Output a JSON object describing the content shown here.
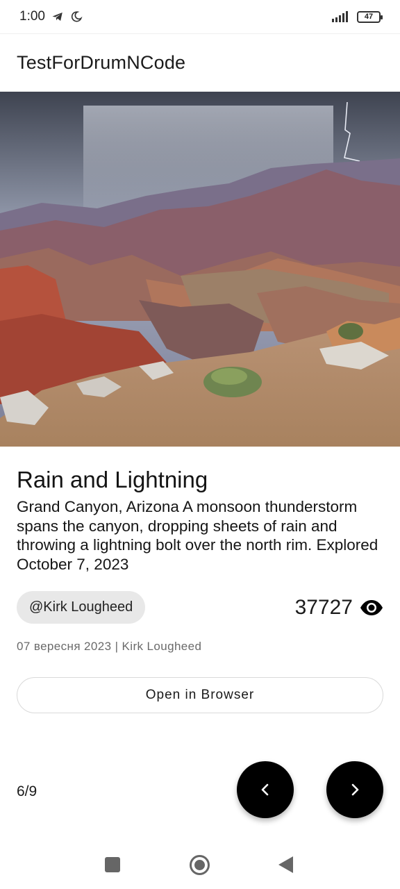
{
  "status_bar": {
    "time": "1:00",
    "battery": "47",
    "icons": [
      "telegram-icon",
      "moon-icon",
      "signal-icon",
      "battery-icon"
    ]
  },
  "app_bar": {
    "title": "TestForDrumNCode"
  },
  "photo": {
    "subject": "grand-canyon-storm-photo"
  },
  "content": {
    "title": "Rain and Lightning",
    "description": "Grand Canyon, Arizona A monsoon thunderstorm spans the canyon, dropping sheets of rain and throwing a lightning bolt over the north rim. Explored October 7, 2023",
    "author_chip": "@Kirk Lougheed",
    "views": "37727",
    "meta": "07 вересня 2023 | Kirk Lougheed",
    "open_button": "Open in Browser"
  },
  "pager": {
    "position": "6/9"
  },
  "nav": {
    "icons": [
      "recents-icon",
      "home-icon",
      "back-icon"
    ]
  },
  "colors": {
    "fab": "#000000",
    "chip_bg": "#e8e8e8",
    "meta_text": "#6a6a6a"
  }
}
